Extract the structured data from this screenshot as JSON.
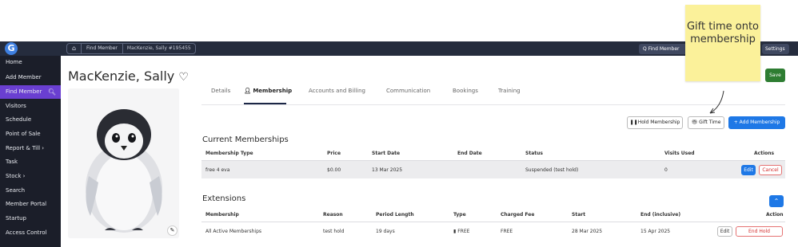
{
  "topbar": {
    "logo_letter": "G",
    "home_icon": "⌂",
    "breadcrumb": [
      "Find Member",
      "MacKenzie, Sally #195455"
    ],
    "find_member_label": "Q Find Member",
    "settings_label": "Settings ⌄"
  },
  "sidebar": {
    "items": [
      {
        "label": "Home"
      },
      {
        "label": "Add Member"
      },
      {
        "label": "Find Member",
        "icon": "search-icon"
      },
      {
        "label": "Visitors"
      },
      {
        "label": "Schedule"
      },
      {
        "label": "Point of Sale"
      },
      {
        "label": "Report & Till ›"
      },
      {
        "label": "Task"
      },
      {
        "label": "Stock ›"
      },
      {
        "label": "Search"
      },
      {
        "label": "Member Portal"
      },
      {
        "label": "Startup"
      },
      {
        "label": "Access Control"
      }
    ],
    "active_index": 2
  },
  "member": {
    "name": "MacKenzie, Sally",
    "heart_icon": "♡",
    "photo": "penguin-chick-photo"
  },
  "tabs": [
    "Details",
    "Membership",
    "Accounts and Billing",
    "Communication",
    "Bookings",
    "Training"
  ],
  "active_tab": "Membership",
  "save_label": "Save",
  "actions": {
    "hold_membership": "Hold Membership",
    "gift_time": "Gift Time",
    "add_membership": "+ Add Membership"
  },
  "current_memberships": {
    "title": "Current Memberships",
    "columns": [
      "Membership Type",
      "Price",
      "Start Date",
      "End Date",
      "Status",
      "Visits Used",
      "Actions"
    ],
    "rows": [
      {
        "type": "free 4 eva",
        "price": "$0.00",
        "start": "13 Mar 2025",
        "end": "",
        "status": "Suspended (test hold)",
        "visits": "0",
        "edit": "Edit",
        "cancel": "Cancel"
      }
    ]
  },
  "extensions": {
    "title": "Extensions",
    "columns": [
      "Membership",
      "Reason",
      "Period Length",
      "Type",
      "Charged Fee",
      "Start",
      "End (inclusive)",
      "Action"
    ],
    "rows": [
      {
        "membership": "All Active Memberships",
        "reason": "test hold",
        "period": "19 days",
        "type": "FREE",
        "fee": "FREE",
        "start": "28 Mar 2025",
        "end": "15 Apr 2025",
        "edit": "Edit",
        "end_hold": "End Hold"
      }
    ]
  },
  "annotation": {
    "text": "Gift time onto membership"
  },
  "colors": {
    "topbar": "#252c3d",
    "sidebar": "#1b1e29",
    "sidebar_active": "#6a3fd1",
    "primary": "#1e78e6",
    "save": "#2e7d32",
    "danger": "#d32f2f",
    "sticky": "#fbf19a"
  }
}
